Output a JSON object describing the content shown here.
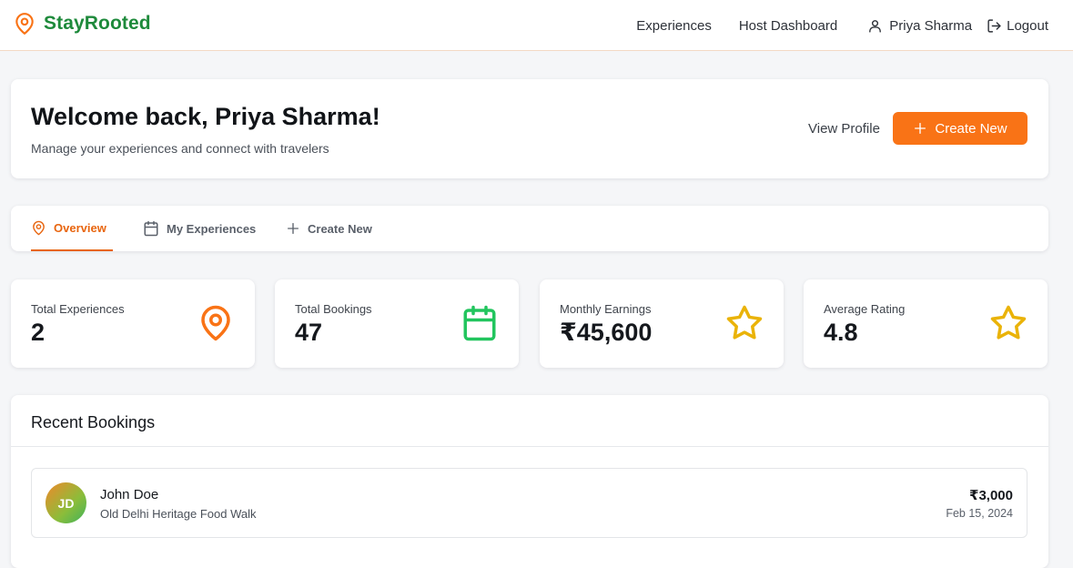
{
  "brand": {
    "name": "StayRooted",
    "icon": "map-pin-icon"
  },
  "nav": {
    "experiences": "Experiences",
    "host_dashboard": "Host Dashboard",
    "user_name": "Priya Sharma",
    "logout": "Logout"
  },
  "welcome": {
    "title": "Welcome back, Priya Sharma!",
    "subtitle": "Manage your experiences and connect with travelers",
    "view_profile": "View Profile",
    "create_new": "Create New"
  },
  "tabs": [
    {
      "label": "Overview",
      "icon": "map-pin-icon",
      "active": true
    },
    {
      "label": "My Experiences",
      "icon": "calendar-icon",
      "active": false
    },
    {
      "label": "Create New",
      "icon": "plus-icon",
      "active": false
    }
  ],
  "stats": [
    {
      "label": "Total Experiences",
      "value": "2",
      "icon": "map-pin-icon",
      "color": "#f97316"
    },
    {
      "label": "Total Bookings",
      "value": "47",
      "icon": "calendar-icon",
      "color": "#22c55e"
    },
    {
      "label": "Monthly Earnings",
      "value": "₹45,600",
      "icon": "star-icon",
      "color": "#eab308"
    },
    {
      "label": "Average Rating",
      "value": "4.8",
      "icon": "star-icon",
      "color": "#eab308"
    }
  ],
  "recent_bookings": {
    "title": "Recent Bookings",
    "items": [
      {
        "initials": "JD",
        "name": "John Doe",
        "experience": "Old Delhi Heritage Food Walk",
        "amount": "₹3,000",
        "date": "Feb 15, 2024"
      }
    ]
  },
  "colors": {
    "accent": "#f97316",
    "brand_text": "#1e8a3b",
    "success": "#22c55e",
    "rating": "#eab308"
  }
}
